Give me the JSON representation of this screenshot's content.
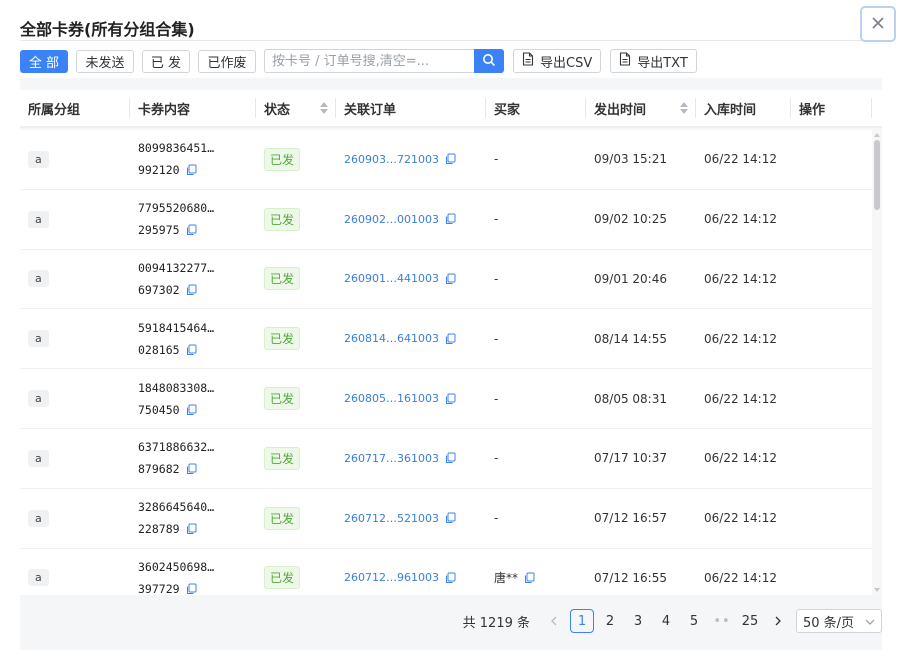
{
  "title": "全部卡券(所有分组合集)",
  "close_icon": "close-icon",
  "filters": {
    "all": "全 部",
    "unsent": "未发送",
    "sent": "已 发",
    "voided": "已作废"
  },
  "search": {
    "placeholder": "按卡号 / 订单号搜,清空=..."
  },
  "exports": {
    "csv": "导出CSV",
    "txt": "导出TXT"
  },
  "columns": [
    "所属分组",
    "卡券内容",
    "状态",
    "关联订单",
    "买家",
    "发出时间",
    "入库时间",
    "操作"
  ],
  "rows": [
    {
      "group": "a",
      "card_l1": "8099836451…",
      "card_l2": "992120",
      "status": "已发",
      "order": "260903…721003",
      "buyer": "-",
      "sent_time": "09/03 15:21",
      "stock_time": "06/22 14:12"
    },
    {
      "group": "a",
      "card_l1": "7795520680…",
      "card_l2": "295975",
      "status": "已发",
      "order": "260902…001003",
      "buyer": "-",
      "sent_time": "09/02 10:25",
      "stock_time": "06/22 14:12"
    },
    {
      "group": "a",
      "card_l1": "0094132277…",
      "card_l2": "697302",
      "status": "已发",
      "order": "260901…441003",
      "buyer": "-",
      "sent_time": "09/01 20:46",
      "stock_time": "06/22 14:12"
    },
    {
      "group": "a",
      "card_l1": "5918415464…",
      "card_l2": "028165",
      "status": "已发",
      "order": "260814…641003",
      "buyer": "-",
      "sent_time": "08/14 14:55",
      "stock_time": "06/22 14:12"
    },
    {
      "group": "a",
      "card_l1": "1848083308…",
      "card_l2": "750450",
      "status": "已发",
      "order": "260805…161003",
      "buyer": "-",
      "sent_time": "08/05 08:31",
      "stock_time": "06/22 14:12"
    },
    {
      "group": "a",
      "card_l1": "6371886632…",
      "card_l2": "879682",
      "status": "已发",
      "order": "260717…361003",
      "buyer": "-",
      "sent_time": "07/17 10:37",
      "stock_time": "06/22 14:12"
    },
    {
      "group": "a",
      "card_l1": "3286645640…",
      "card_l2": "228789",
      "status": "已发",
      "order": "260712…521003",
      "buyer": "-",
      "sent_time": "07/12 16:57",
      "stock_time": "06/22 14:12"
    },
    {
      "group": "a",
      "card_l1": "3602450698…",
      "card_l2": "397729",
      "status": "已发",
      "order": "260712…961003",
      "buyer": "唐**",
      "sent_time": "07/12 16:55",
      "stock_time": "06/22 14:12"
    }
  ],
  "pagination": {
    "total": "共 1219 条",
    "pages": [
      "1",
      "2",
      "3",
      "4",
      "5"
    ],
    "ellipsis": "••",
    "last": "25",
    "current": "1",
    "page_size": "50 条/页"
  }
}
